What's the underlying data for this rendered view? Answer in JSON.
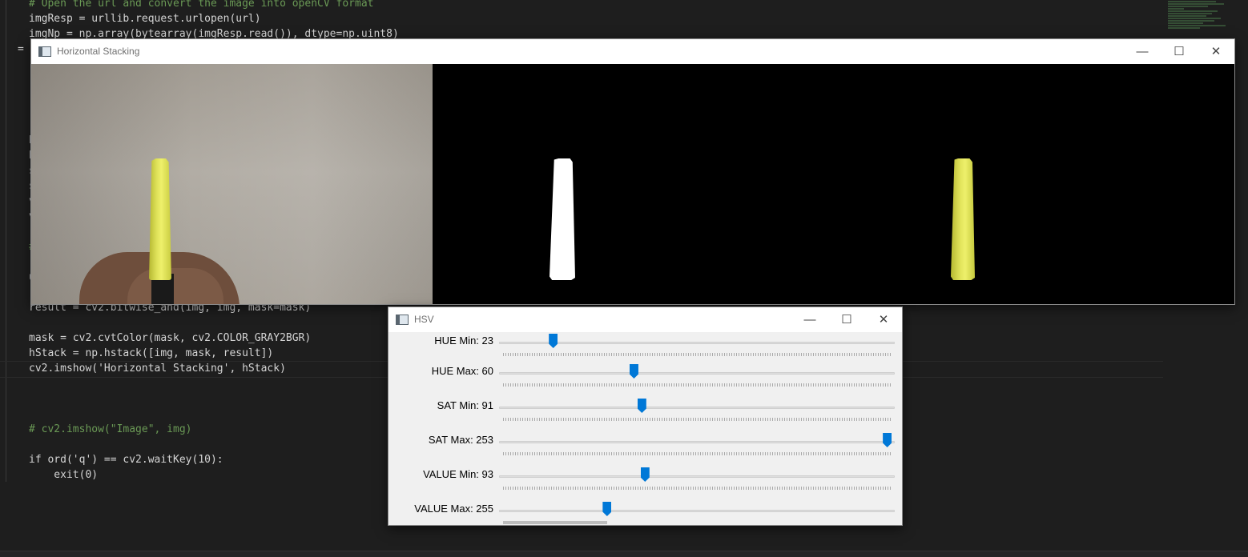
{
  "editor": {
    "lines": [
      "# Open the url and convert the image into openCV format",
      "imgResp = urllib.request.urlopen(url)",
      "imgNp = np.array(bytearray(imgResp.read()), dtype=np.uint8)",
      "result = cv2.bitwise_and(img, img, mask=mask)",
      "mask = cv2.cvtColor(mask, cv2.COLOR_GRAY2BGR)",
      "hStack = np.hstack([img, mask, result])",
      "cv2.imshow('Horizontal Stacking', hStack)",
      "# cv2.imshow(\"Image\", img)",
      "if ord('q') == cv2.waitKey(10):",
      "    exit(0)"
    ],
    "gutter_fragments": [
      "= \"",
      "h",
      "h",
      "s",
      "s",
      "v",
      "v",
      "u",
      "r",
      "#"
    ]
  },
  "stack_window": {
    "title": "Horizontal Stacking",
    "icon": "opencv-window-icon",
    "controls": {
      "minimize": "—",
      "maximize": "☐",
      "close": "✕"
    }
  },
  "hsv_window": {
    "title": "HSV",
    "icon": "opencv-window-icon",
    "controls": {
      "minimize": "—",
      "maximize": "☐",
      "close": "✕"
    },
    "sliders": [
      {
        "label": "HUE Min: 23",
        "value": 23,
        "max": 179
      },
      {
        "label": "HUE Max: 60",
        "value": 60,
        "max": 179
      },
      {
        "label": "SAT Min: 91",
        "value": 91,
        "max": 255
      },
      {
        "label": "SAT Max: 253",
        "value": 253,
        "max": 255
      },
      {
        "label": "VALUE Min: 93",
        "value": 93,
        "max": 255
      },
      {
        "label": "VALUE Max: 255",
        "value": 255,
        "max": 255
      }
    ],
    "slider_fraction": [
      0.136,
      0.34,
      0.36,
      0.98,
      0.368,
      0.272
    ]
  },
  "colors": {
    "editor_bg": "#1e1e1e",
    "slider_thumb": "#0078d7",
    "marker_yellow": "#e2e45c"
  }
}
